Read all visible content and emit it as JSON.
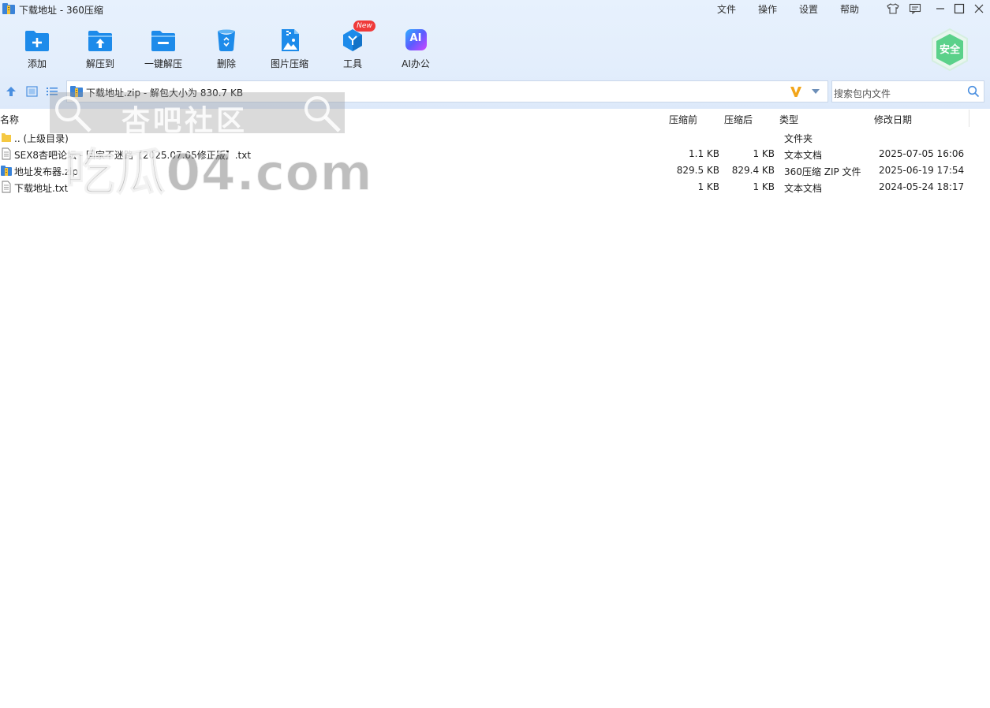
{
  "window": {
    "title": "下载地址 - 360压缩",
    "menu": [
      "文件",
      "操作",
      "设置",
      "帮助"
    ]
  },
  "toolbar": {
    "items": [
      {
        "label": "添加",
        "icon": "add-folder-icon"
      },
      {
        "label": "解压到",
        "icon": "extract-to-icon"
      },
      {
        "label": "一键解压",
        "icon": "one-click-extract-icon"
      },
      {
        "label": "删除",
        "icon": "recycle-bin-icon"
      },
      {
        "label": "图片压缩",
        "icon": "image-compress-icon"
      },
      {
        "label": "工具",
        "icon": "tools-cube-icon"
      },
      {
        "label": "AI办公",
        "icon": "ai-office-icon"
      }
    ],
    "new_badge": "New",
    "security_label": "安全"
  },
  "address": {
    "text": "下载地址.zip - 解包大小为 830.7 KB",
    "search_placeholder": "搜索包内文件"
  },
  "columns": {
    "name": "名称",
    "compressed": "压缩前",
    "original": "压缩后",
    "type": "类型",
    "modified": "修改日期"
  },
  "files": [
    {
      "name": ".. (上级目录)",
      "compressed": "",
      "original": "",
      "type": "文件夹",
      "modified": "",
      "icon": "folder-icon"
    },
    {
      "name": "SEX8杏吧论坛 - 回家不迷路【2025.07.05修正版】.txt",
      "compressed": "1.1 KB",
      "original": "1 KB",
      "type": "文本文档",
      "modified": "2025-07-05 16:06",
      "icon": "text-file-icon"
    },
    {
      "name": "地址发布器.zip",
      "compressed": "829.5 KB",
      "original": "829.4 KB",
      "type": "360压缩 ZIP 文件",
      "modified": "2025-06-19 17:54",
      "icon": "zip-file-icon"
    },
    {
      "name": "下载地址.txt",
      "compressed": "1 KB",
      "original": "1 KB",
      "type": "文本文档",
      "modified": "2024-05-24 18:17",
      "icon": "text-file-icon"
    }
  ],
  "watermark": {
    "line1": "杏吧社区",
    "line2": "吃瓜04.com"
  },
  "colors": {
    "accent": "#1a8de8",
    "toolbar_bg": "#e5effc",
    "security_green": "#5bd18a",
    "new_badge": "#ef3a3a",
    "ai_gradient_start": "#3b6cff",
    "ai_gradient_end": "#c34dff"
  }
}
